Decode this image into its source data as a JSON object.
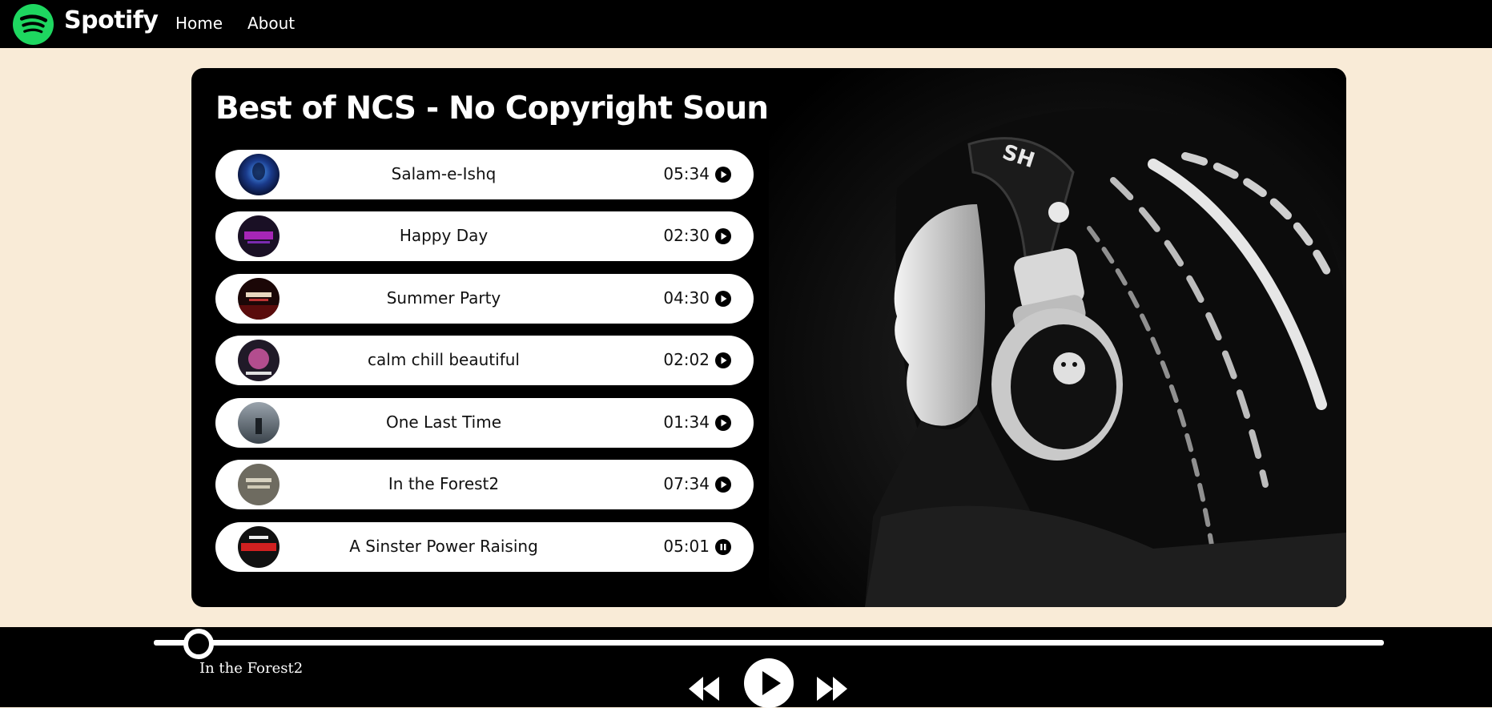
{
  "nav": {
    "brand": "Spotify",
    "links": [
      "Home",
      "About"
    ]
  },
  "playlist": {
    "title": "Best of NCS - No Copyright Sounds",
    "songs": [
      {
        "name": "Salam-e-Ishq",
        "duration": "05:34",
        "state": "play"
      },
      {
        "name": "Happy Day",
        "duration": "02:30",
        "state": "play"
      },
      {
        "name": "Summer Party",
        "duration": "04:30",
        "state": "play"
      },
      {
        "name": "calm chill beautiful",
        "duration": "02:02",
        "state": "play"
      },
      {
        "name": "One Last Time",
        "duration": "01:34",
        "state": "play"
      },
      {
        "name": "In the Forest2",
        "duration": "07:34",
        "state": "play"
      },
      {
        "name": "A Sinster Power Raising",
        "duration": "05:01",
        "state": "pause"
      }
    ]
  },
  "player": {
    "now_playing": "In the Forest2",
    "progress": 0.035,
    "controls": [
      "backward-icon",
      "play-icon",
      "forward-icon"
    ]
  },
  "colors": {
    "accent": "#1ed760",
    "background": "#f9ebd7",
    "bar": "#000000"
  }
}
